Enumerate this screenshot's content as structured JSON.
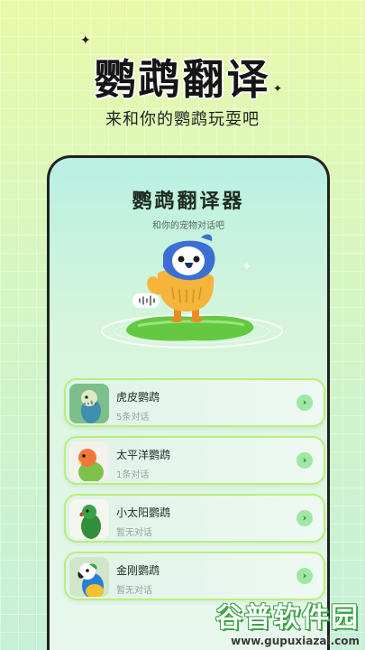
{
  "hero": {
    "title": "鹦鹉翻译",
    "subtitle": "来和你的鹦鹉玩耍吧"
  },
  "app": {
    "title": "鹦鹉翻译器",
    "subtitle": "和你的宠物对话吧"
  },
  "parrots": [
    {
      "name": "虎皮鹦鹉",
      "status": "5条对话",
      "icon": "budgie-avatar"
    },
    {
      "name": "太平洋鹦鹉",
      "status": "1条对话",
      "icon": "lovebird-avatar"
    },
    {
      "name": "小太阳鹦鹉",
      "status": "暂无对话",
      "icon": "green-parrot-avatar"
    },
    {
      "name": "金刚鹦鹉",
      "status": "暂无对话",
      "icon": "macaw-avatar"
    }
  ],
  "watermark": {
    "main": "谷普软件园",
    "url": "www.gupuxiazai.com"
  },
  "colors": {
    "accent": "#b8f07a",
    "arrow_bg": "#9fe8a3",
    "mascot_body": "#f5b43a",
    "mascot_head": "#3b6fd4"
  }
}
